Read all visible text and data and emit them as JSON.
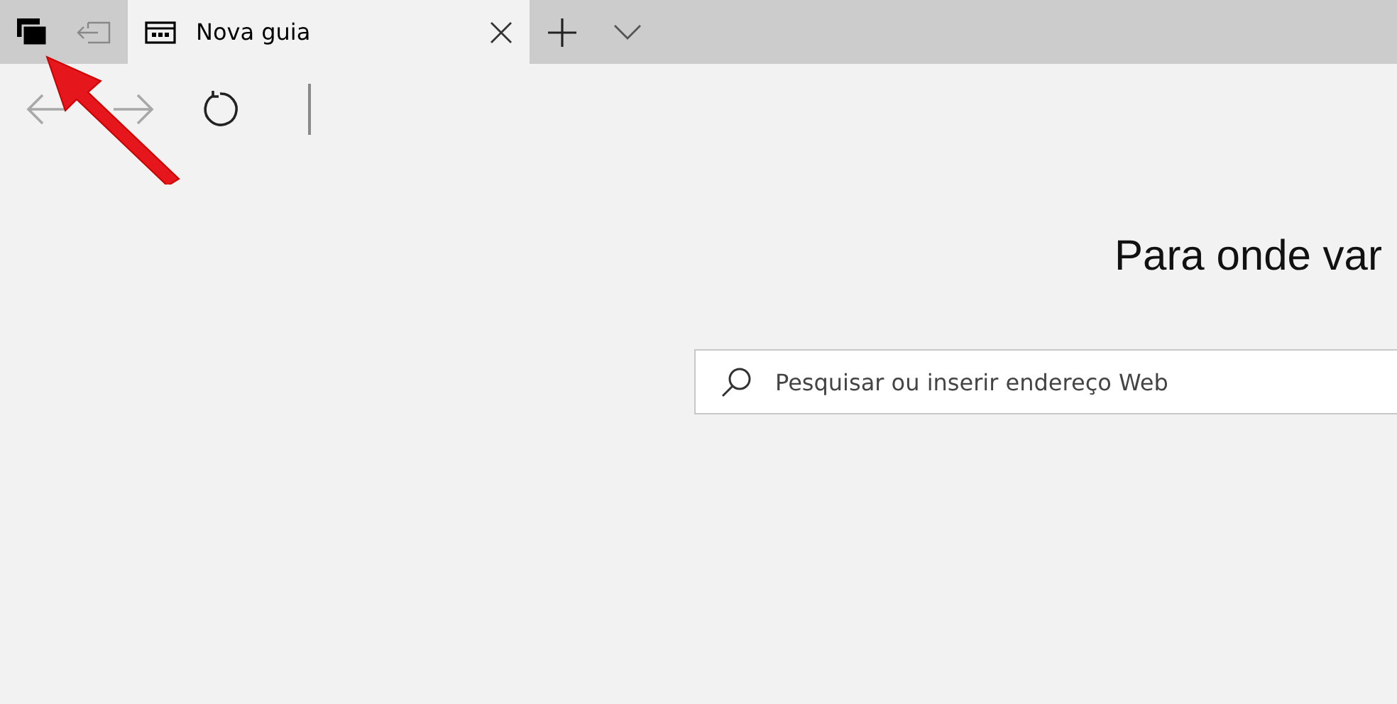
{
  "tab_bar": {
    "tabs": [
      {
        "title": "Nova guia",
        "selected": true
      }
    ]
  },
  "toolbar": {
    "buttons": [
      {
        "kind": "back",
        "disabled": true
      },
      {
        "kind": "forward",
        "disabled": true
      },
      {
        "kind": "refresh",
        "disabled": false
      }
    ]
  },
  "new_tab_page": {
    "heading": "Para onde var",
    "search": {
      "placeholder": "Pesquisar ou inserir endereço Web"
    }
  }
}
